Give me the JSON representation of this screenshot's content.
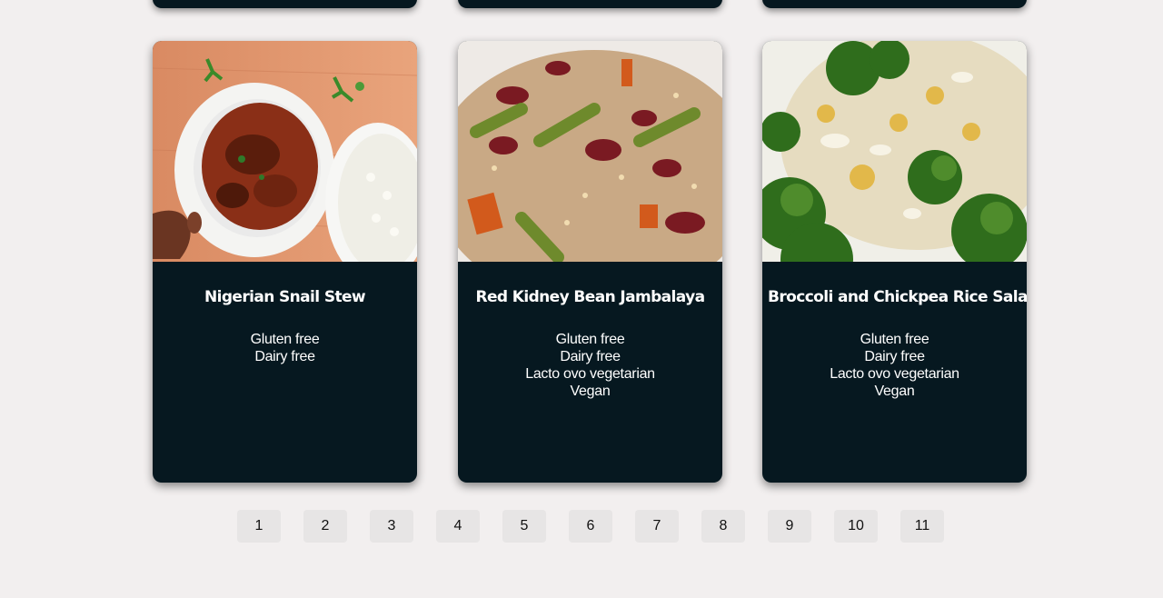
{
  "recipes": [
    {
      "title": "Nigerian Snail Stew",
      "diets": [
        "Gluten free",
        "Dairy free"
      ]
    },
    {
      "title": "Red Kidney Bean Jambalaya",
      "diets": [
        "Gluten free",
        "Dairy free",
        "Lacto ovo vegetarian",
        "Vegan"
      ]
    },
    {
      "title": "Broccoli and Chickpea Rice Salad",
      "diets": [
        "Gluten free",
        "Dairy free",
        "Lacto ovo vegetarian",
        "Vegan"
      ]
    }
  ],
  "pagination": {
    "pages": [
      "1",
      "2",
      "3",
      "4",
      "5",
      "6",
      "7",
      "8",
      "9",
      "10",
      "11"
    ]
  },
  "colors": {
    "background": "#f2efef",
    "card": "#061820",
    "card_text": "#ffffff",
    "page_button": "#e7e5e5"
  }
}
